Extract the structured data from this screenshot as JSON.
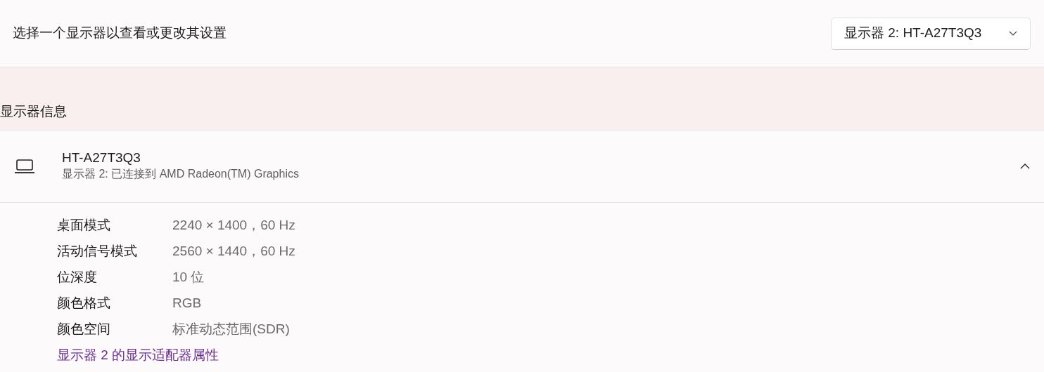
{
  "prompt": "选择一个显示器以查看或更改其设置",
  "display_select": {
    "value": "显示器 2: HT-A27T3Q3"
  },
  "section_title": "显示器信息",
  "display_card": {
    "name": "HT-A27T3Q3",
    "description": "显示器 2: 已连接到 AMD Radeon(TM) Graphics",
    "expanded": true,
    "properties": [
      {
        "label": "桌面模式",
        "value": "2240 × 1400，60 Hz"
      },
      {
        "label": "活动信号模式",
        "value": "2560 × 1440，60 Hz"
      },
      {
        "label": "位深度",
        "value": "10 位"
      },
      {
        "label": "颜色格式",
        "value": "RGB"
      },
      {
        "label": "颜色空间",
        "value": "标准动态范围(SDR)"
      }
    ],
    "link": "显示器 2 的显示适配器属性"
  }
}
